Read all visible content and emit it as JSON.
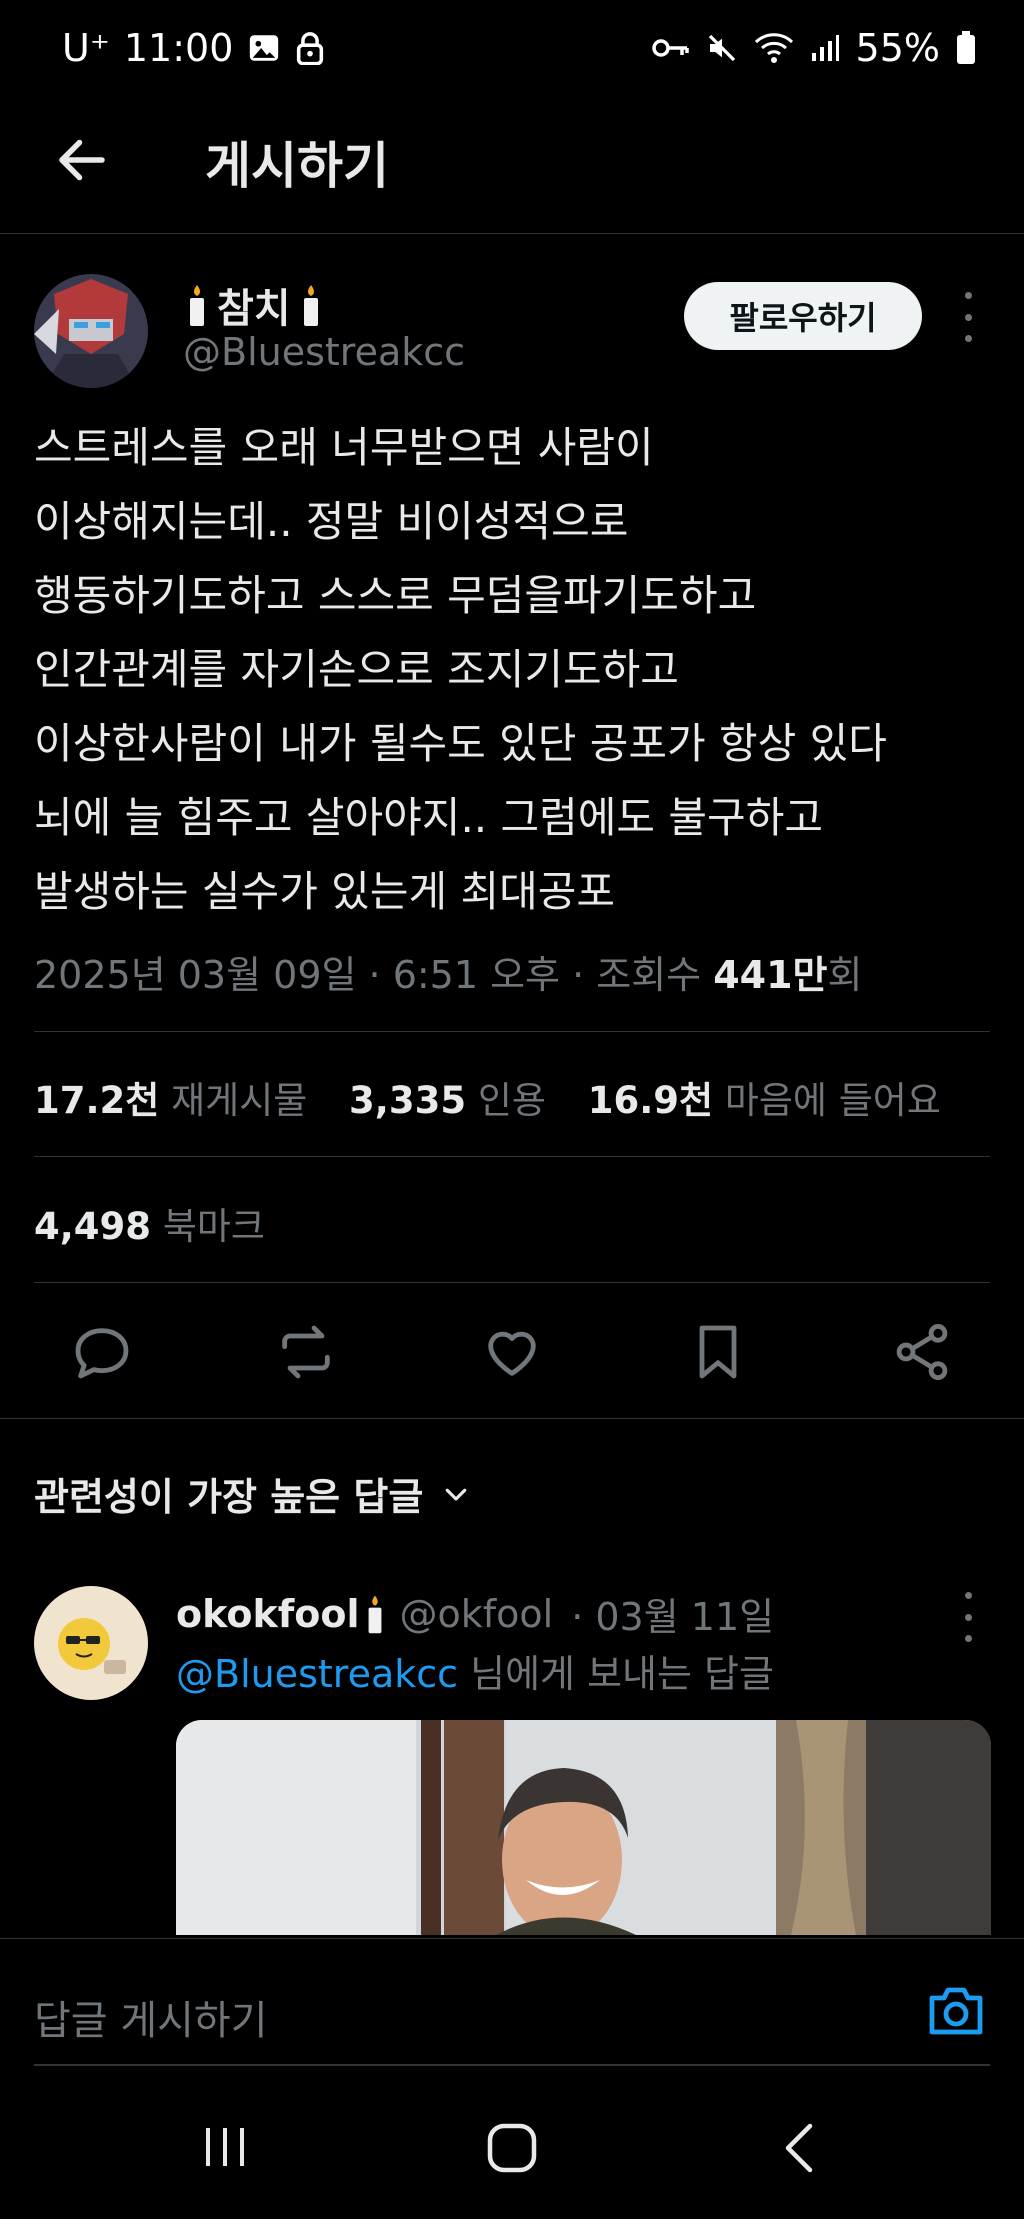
{
  "status_bar": {
    "carrier": "U⁺",
    "time": "11:00",
    "battery": "55%"
  },
  "header": {
    "title": "게시하기"
  },
  "post": {
    "author_name": "참치",
    "author_handle": "@Bluestreakcc",
    "follow_label": "팔로우하기",
    "lines": [
      "스트레스를 오래 너무받으면 사람이",
      "이상해지는데.. 정말 비이성적으로",
      "행동하기도하고 스스로 무덤을파기도하고",
      "인간관계를 자기손으로 조지기도하고",
      "이상한사람이 내가 될수도 있단 공포가 항상 있다",
      "뇌에 늘 힘주고 살아야지.. 그럼에도 불구하고",
      "발생하는 실수가 있는게 최대공포"
    ],
    "date": "2025년 03월 09일 · 6:51 오후 · 조회수 ",
    "views": "441만",
    "views_suffix": "회",
    "reposts_count": "17.2천",
    "reposts_label": "재게시물",
    "quotes_count": "3,335",
    "quotes_label": "인용",
    "likes_count": "16.9천",
    "likes_label": "마음에 들어요",
    "bookmarks_count": "4,498",
    "bookmarks_label": "북마크"
  },
  "replies": {
    "sort_label": "관련성이 가장 높은 답글",
    "items": [
      {
        "name": "okokfool",
        "handle": "@okfool",
        "date": "· 03월 11일",
        "reply_to_handle": "@Bluestreakcc",
        "reply_to_suffix": " 님에게 보내는 답글"
      }
    ]
  },
  "composer": {
    "placeholder": "답글 게시하기"
  },
  "colors": {
    "background": "#000000",
    "text": "#e7e9ea",
    "muted": "#71767b",
    "accent": "#1d9bf0",
    "divider": "#2f3336"
  },
  "icons": [
    "back-arrow-icon",
    "candle-icon",
    "more-icon",
    "reply-icon",
    "repost-icon",
    "like-icon",
    "bookmark-icon",
    "share-icon",
    "chevron-down-icon",
    "camera-icon",
    "recents-icon",
    "home-icon",
    "nav-back-icon"
  ]
}
